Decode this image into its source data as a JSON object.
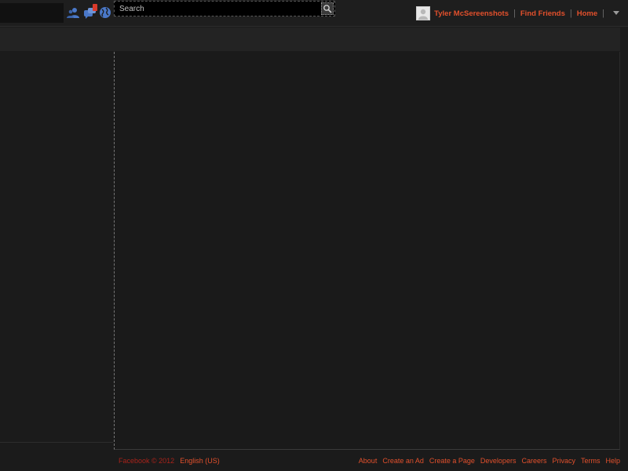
{
  "colors": {
    "background": "#1b1b1b",
    "link_accent": "#e2502c",
    "copyright": "#a8231b",
    "notification_badge": "#d93a2b",
    "jewel_blue": "#4a78c8"
  },
  "topbar": {
    "jewels": [
      {
        "name": "friend-requests-icon"
      },
      {
        "name": "messages-icon"
      },
      {
        "name": "notifications-globe-icon"
      }
    ],
    "search": {
      "placeholder": "Search",
      "icon": "search-icon"
    },
    "user": {
      "name": "Tyler McSereenshots",
      "avatar_icon": "avatar-icon"
    },
    "links": {
      "find_friends": "Find Friends",
      "home": "Home"
    },
    "account_menu_icon": "chevron-down-icon"
  },
  "footer": {
    "copyright": "Facebook © 2012",
    "language": "English (US)",
    "links": [
      "About",
      "Create an Ad",
      "Create a Page",
      "Developers",
      "Careers",
      "Privacy",
      "Terms",
      "Help"
    ]
  }
}
